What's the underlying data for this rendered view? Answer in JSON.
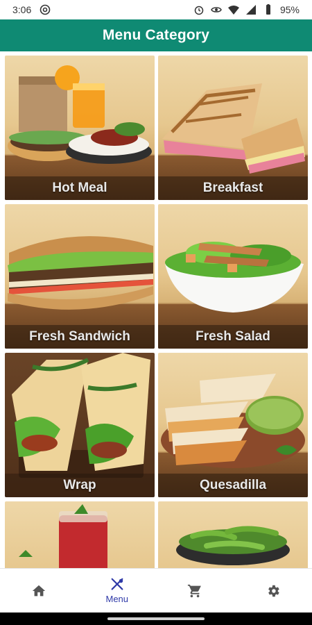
{
  "status_bar": {
    "time": "3:06",
    "battery": "95%",
    "icons": [
      "at-sign-icon",
      "alarm-icon",
      "eye-icon",
      "wifi-icon",
      "signal-icon",
      "battery-icon"
    ]
  },
  "app_bar": {
    "title": "Menu Category"
  },
  "categories": [
    {
      "label": "Hot Meal"
    },
    {
      "label": "Breakfast"
    },
    {
      "label": "Fresh Sandwich"
    },
    {
      "label": "Fresh Salad"
    },
    {
      "label": "Wrap"
    },
    {
      "label": "Quesadilla"
    },
    {
      "label": ""
    },
    {
      "label": ""
    }
  ],
  "bottom_nav": {
    "items": [
      {
        "icon": "home-icon",
        "label": ""
      },
      {
        "icon": "menu-icon",
        "label": "Menu",
        "active": true
      },
      {
        "icon": "cart-icon",
        "label": ""
      },
      {
        "icon": "settings-icon",
        "label": ""
      }
    ]
  },
  "colors": {
    "app_bar": "#0f8a73",
    "nav_active": "#2f3aa8",
    "nav_inactive": "#555555"
  }
}
